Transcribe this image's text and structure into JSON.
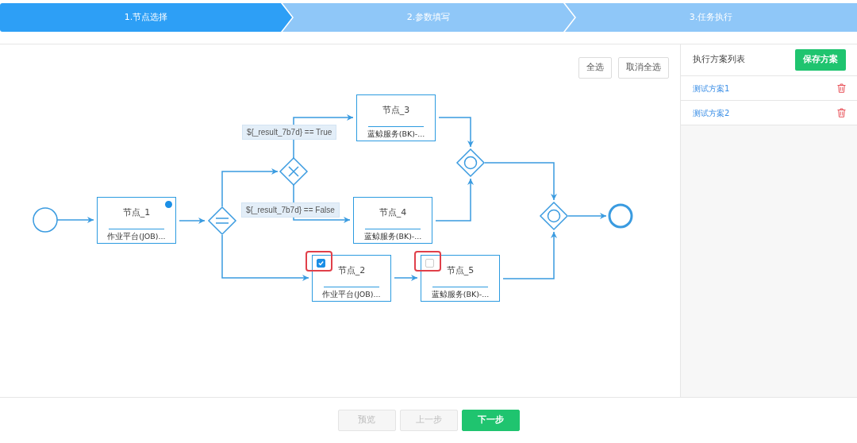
{
  "steps": [
    {
      "label": "1.节点选择",
      "selected": true
    },
    {
      "label": "2.参数填写",
      "selected": false
    },
    {
      "label": "3.任务执行",
      "selected": false
    }
  ],
  "toolbar": {
    "buttons": [
      "全选",
      "取消全选"
    ]
  },
  "diagram": {
    "nodes": [
      {
        "title": "节点_1",
        "subtitle": "作业平台(JOB)...",
        "kind": "plain",
        "info": true
      },
      {
        "title": "节点_2",
        "subtitle": "作业平台(JOB)...",
        "kind": "selectable",
        "checked": true,
        "highlighted": true,
        "info": false
      },
      {
        "title": "节点_3",
        "subtitle": "蓝鲸服务(BK)-...",
        "kind": "plain",
        "info": false
      },
      {
        "title": "节点_4",
        "subtitle": "蓝鲸服务(BK)-...",
        "kind": "plain",
        "info": false
      },
      {
        "title": "节点_5",
        "subtitle": "蓝鲸服务(BK)-...",
        "kind": "selectable",
        "checked": false,
        "highlighted": true,
        "info": false
      }
    ],
    "conditions": [
      "${_result_7b7d} == True",
      "${_result_7b7d} == False"
    ]
  },
  "sidebar": {
    "title": "执行方案列表",
    "save_button": "保存方案",
    "plans": [
      {
        "name": "测试方案1"
      },
      {
        "name": "测试方案2"
      }
    ]
  },
  "footer": {
    "buttons": [
      {
        "label": "预览",
        "disabled": true
      },
      {
        "label": "上一步",
        "disabled": true
      },
      {
        "label": "下一步",
        "disabled": false
      }
    ]
  }
}
